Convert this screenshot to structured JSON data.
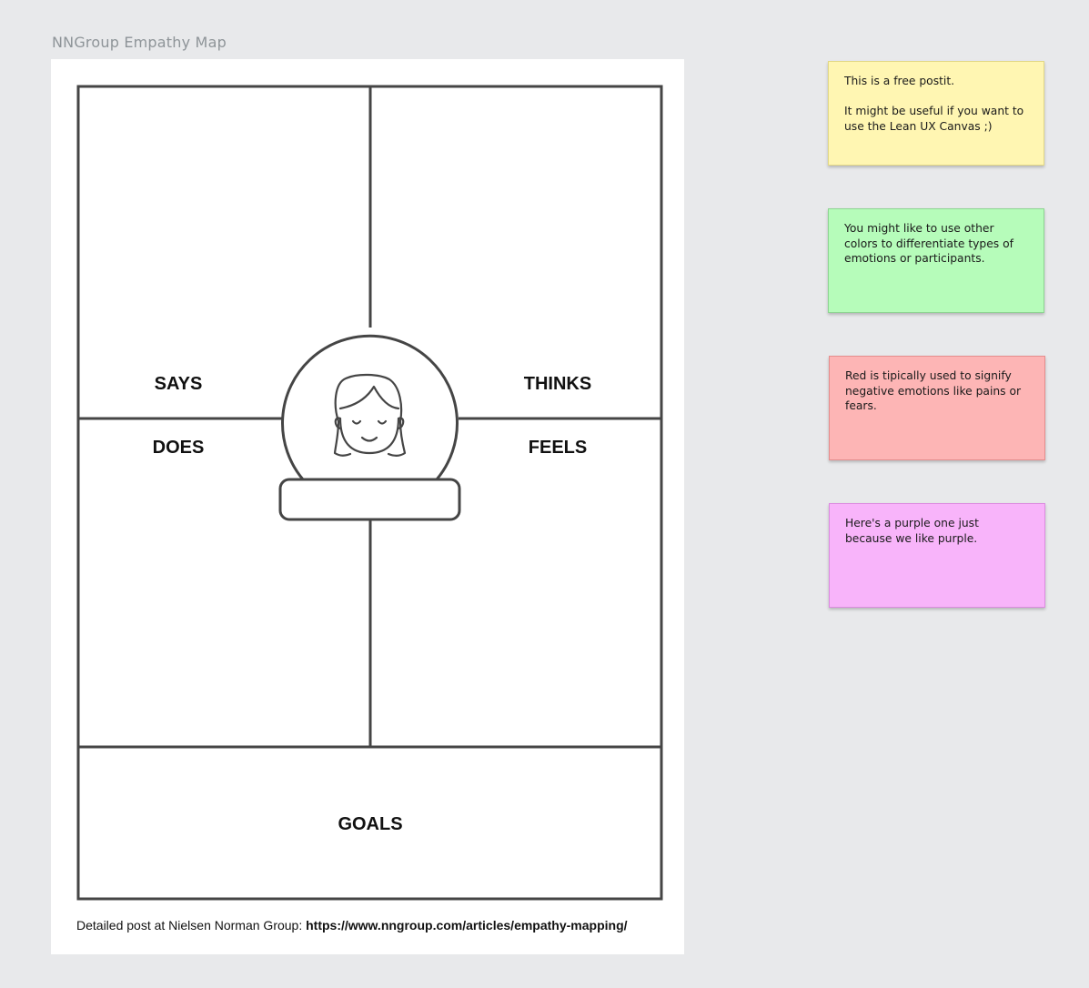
{
  "frame": {
    "title": "NNGroup Empathy Map"
  },
  "empathy_map": {
    "quadrants": {
      "says": "SAYS",
      "thinks": "THINKS",
      "does": "DOES",
      "feels": "FEELS"
    },
    "goals": "GOALS",
    "persona_icon": "woman-avatar-icon",
    "footer": {
      "prefix": "Detailed post at Nielsen Norman Group: ",
      "link": "https://www.nngroup.com/articles/empathy-mapping/"
    }
  },
  "postits": [
    {
      "text": "This is a free postit.\n\nIt might be useful if you want to use the Lean UX Canvas ;)",
      "color": "#fff6b2",
      "border": "#e2d886"
    },
    {
      "text": "You might like to use other colors to differentiate types of emotions or participants.",
      "color": "#b6fcba",
      "border": "#8fd493"
    },
    {
      "text": "Red is tipically used to signify negative emotions like pains or fears.",
      "color": "#fdb5b5",
      "border": "#e58e8e"
    },
    {
      "text": "Here's a purple one just because we like purple.",
      "color": "#f8b4fa",
      "border": "#dc8ce0"
    }
  ]
}
